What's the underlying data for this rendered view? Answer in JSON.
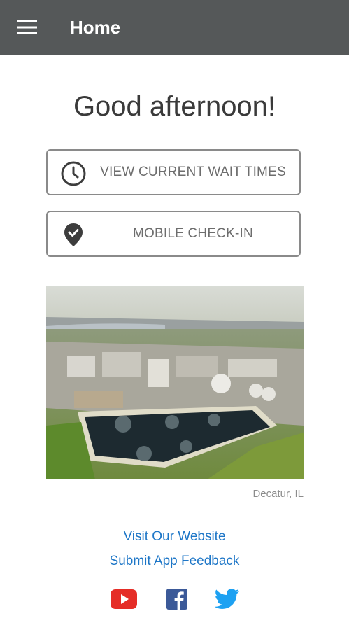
{
  "header": {
    "title": "Home",
    "menu_icon": "hamburger-menu-icon",
    "background": "#555859"
  },
  "greeting": "Good afternoon!",
  "actions": [
    {
      "label": "VIEW CURRENT WAIT TIMES",
      "icon": "clock-icon"
    },
    {
      "label": "MOBILE CHECK-IN",
      "icon": "location-check-icon"
    }
  ],
  "photo": {
    "caption": "Decatur, IL",
    "icon": "aerial-industrial-plant-photo"
  },
  "links": {
    "website": "Visit Our Website",
    "feedback": "Submit App Feedback",
    "color": "#1d76c7"
  },
  "social": [
    {
      "icon": "youtube-icon",
      "color": "#e52d27"
    },
    {
      "icon": "facebook-icon",
      "color": "#3b5998"
    },
    {
      "icon": "twitter-icon",
      "color": "#1da1f2"
    }
  ]
}
